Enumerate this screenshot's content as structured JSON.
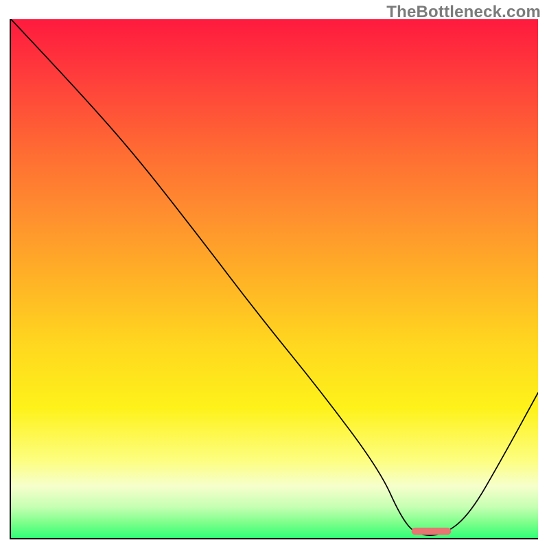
{
  "watermark": "TheBottleneck.com",
  "chart_data": {
    "type": "line",
    "title": "",
    "xlabel": "",
    "ylabel": "",
    "xlim": [
      0,
      1000
    ],
    "ylim": [
      0,
      1000
    ],
    "grid": false,
    "legend": false,
    "gradient_stops": [
      {
        "pos": 0.0,
        "color": "#ff1a3e"
      },
      {
        "pos": 0.12,
        "color": "#ff403b"
      },
      {
        "pos": 0.25,
        "color": "#ff6a33"
      },
      {
        "pos": 0.37,
        "color": "#ff8d2f"
      },
      {
        "pos": 0.5,
        "color": "#ffb226"
      },
      {
        "pos": 0.63,
        "color": "#ffd81f"
      },
      {
        "pos": 0.75,
        "color": "#fef21a"
      },
      {
        "pos": 0.85,
        "color": "#fdfe7f"
      },
      {
        "pos": 0.9,
        "color": "#f6ffcc"
      },
      {
        "pos": 0.94,
        "color": "#c6ffb3"
      },
      {
        "pos": 0.97,
        "color": "#7fff8c"
      },
      {
        "pos": 1.0,
        "color": "#30ff76"
      }
    ],
    "series": [
      {
        "name": "bottleneck-curve",
        "x": [
          0,
          120,
          230,
          350,
          470,
          590,
          700,
          740,
          770,
          820,
          870,
          930,
          1000
        ],
        "y": [
          1000,
          870,
          745,
          590,
          430,
          280,
          130,
          40,
          5,
          5,
          45,
          150,
          280
        ]
      }
    ],
    "marker": {
      "name": "optimal-range-marker",
      "color": "#e77572",
      "x_start": 760,
      "x_end": 835,
      "y": 6,
      "height": 14,
      "rx": 7
    }
  }
}
